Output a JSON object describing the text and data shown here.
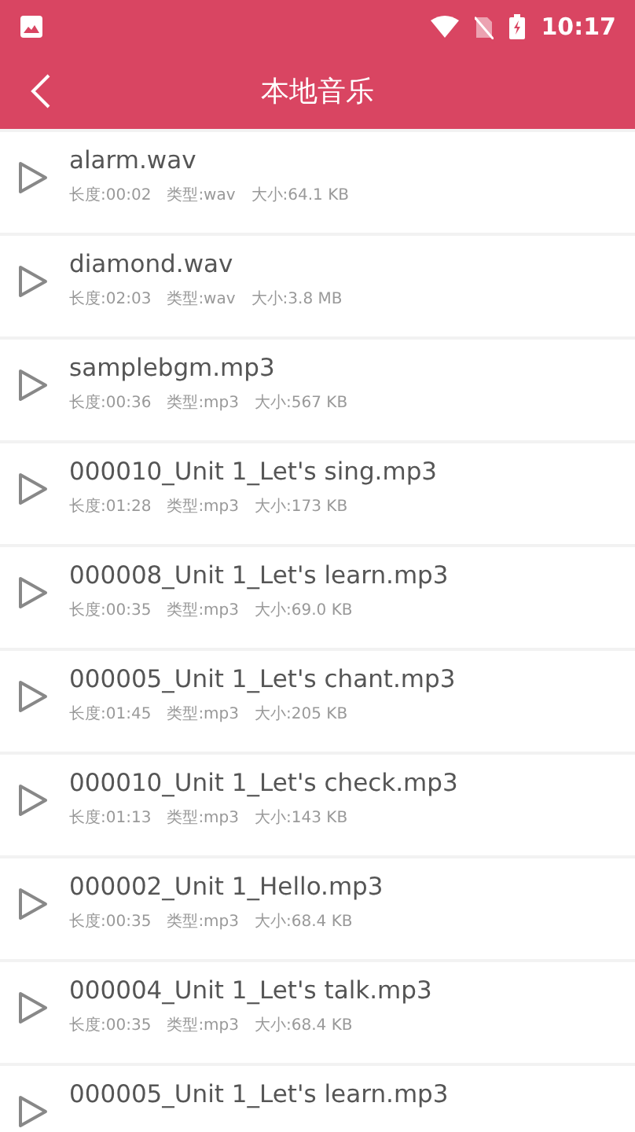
{
  "status_bar": {
    "time": "10:17"
  },
  "toolbar": {
    "title": "本地音乐"
  },
  "tracks": [
    {
      "name": "alarm.wav",
      "length": "长度:00:02",
      "type": "类型:wav",
      "size": "大小:64.1 KB"
    },
    {
      "name": "diamond.wav",
      "length": "长度:02:03",
      "type": "类型:wav",
      "size": "大小:3.8 MB"
    },
    {
      "name": "samplebgm.mp3",
      "length": "长度:00:36",
      "type": "类型:mp3",
      "size": "大小:567 KB"
    },
    {
      "name": "000010_Unit 1_Let's sing.mp3",
      "length": "长度:01:28",
      "type": "类型:mp3",
      "size": "大小:173 KB"
    },
    {
      "name": "000008_Unit 1_Let's learn.mp3",
      "length": "长度:00:35",
      "type": "类型:mp3",
      "size": "大小:69.0 KB"
    },
    {
      "name": "000005_Unit 1_Let's chant.mp3",
      "length": "长度:01:45",
      "type": "类型:mp3",
      "size": "大小:205 KB"
    },
    {
      "name": "000010_Unit 1_Let's check.mp3",
      "length": "长度:01:13",
      "type": "类型:mp3",
      "size": "大小:143 KB"
    },
    {
      "name": "000002_Unit 1_Hello.mp3",
      "length": "长度:00:35",
      "type": "类型:mp3",
      "size": "大小:68.4 KB"
    },
    {
      "name": "000004_Unit 1_Let's talk.mp3",
      "length": "长度:00:35",
      "type": "类型:mp3",
      "size": "大小:68.4 KB"
    },
    {
      "name": "000005_Unit 1_Let's learn.mp3"
    }
  ]
}
